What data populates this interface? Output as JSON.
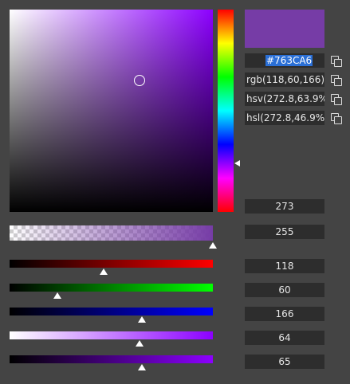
{
  "color": {
    "hex": "#763CA6",
    "preview": "#763CA6"
  },
  "formats": {
    "hex": "#763CA6",
    "rgb": "rgb(118,60,166)",
    "hsv": "hsv(272.8,63.9%,65.1%)",
    "hsl": "hsl(272.8,46.9%,44.3%)"
  },
  "picker": {
    "hue_value": 273,
    "hue_fraction": 0.758,
    "saturation_fraction": 0.639,
    "value_fraction": 0.651
  },
  "sliders": {
    "alpha": {
      "value": "255",
      "fraction": 1.0
    },
    "red": {
      "value": "118",
      "fraction": 0.463
    },
    "green": {
      "value": "60",
      "fraction": 0.235
    },
    "blue": {
      "value": "166",
      "fraction": 0.651
    },
    "saturation": {
      "value": "64",
      "fraction": 0.64
    },
    "value": {
      "value": "65",
      "fraction": 0.65
    }
  },
  "fields": {
    "hue": "273",
    "alpha": "255",
    "red": "118",
    "green": "60",
    "blue": "166",
    "saturation": "64",
    "value": "65"
  },
  "icons": {
    "copy": "copy-icon"
  }
}
